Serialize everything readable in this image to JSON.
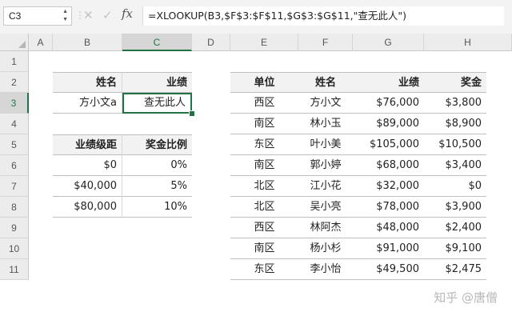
{
  "formula_bar": {
    "name_box": "C3",
    "cancel_icon": "cancel-icon",
    "confirm_icon": "confirm-icon",
    "fx_icon": "fx-icon",
    "fx_label": "fx",
    "formula": "=XLOOKUP(B3,$F$3:$F$11,$G$3:$G$11,\"查无此人\")"
  },
  "columns": [
    "A",
    "B",
    "C",
    "D",
    "E",
    "F",
    "G",
    "H"
  ],
  "rows": [
    "1",
    "2",
    "3",
    "4",
    "5",
    "6",
    "7",
    "8",
    "9",
    "10",
    "11"
  ],
  "selected_cell": "C3",
  "lookup_table": {
    "header": {
      "name": "姓名",
      "result": "业绩"
    },
    "row": {
      "name": "方小文a",
      "result": "查无此人"
    }
  },
  "bonus_table": {
    "header": {
      "level": "业绩级距",
      "rate": "奖金比例"
    },
    "rows": [
      {
        "level": "$0",
        "rate": "0%"
      },
      {
        "level": "$40,000",
        "rate": "5%"
      },
      {
        "level": "$80,000",
        "rate": "10%"
      }
    ]
  },
  "data_table": {
    "header": {
      "region": "单位",
      "name": "姓名",
      "sales": "业绩",
      "bonus": "奖金"
    },
    "rows": [
      {
        "region": "西区",
        "name": "方小文",
        "sales": "$76,000",
        "bonus": "$3,800"
      },
      {
        "region": "南区",
        "name": "林小玉",
        "sales": "$89,000",
        "bonus": "$8,900"
      },
      {
        "region": "东区",
        "name": "叶小美",
        "sales": "$105,000",
        "bonus": "$10,500"
      },
      {
        "region": "南区",
        "name": "郭小婷",
        "sales": "$68,000",
        "bonus": "$3,400"
      },
      {
        "region": "北区",
        "name": "江小花",
        "sales": "$32,000",
        "bonus": "$0"
      },
      {
        "region": "北区",
        "name": "吴小亮",
        "sales": "$78,000",
        "bonus": "$3,900"
      },
      {
        "region": "西区",
        "name": "林阿杰",
        "sales": "$48,000",
        "bonus": "$2,400"
      },
      {
        "region": "南区",
        "name": "杨小杉",
        "sales": "$91,000",
        "bonus": "$9,100"
      },
      {
        "region": "东区",
        "name": "李小怡",
        "sales": "$49,500",
        "bonus": "$2,475"
      }
    ]
  },
  "watermark": "知乎 @唐僧",
  "colors": {
    "accent": "#217346",
    "header_fill": "#f2f2f2"
  }
}
